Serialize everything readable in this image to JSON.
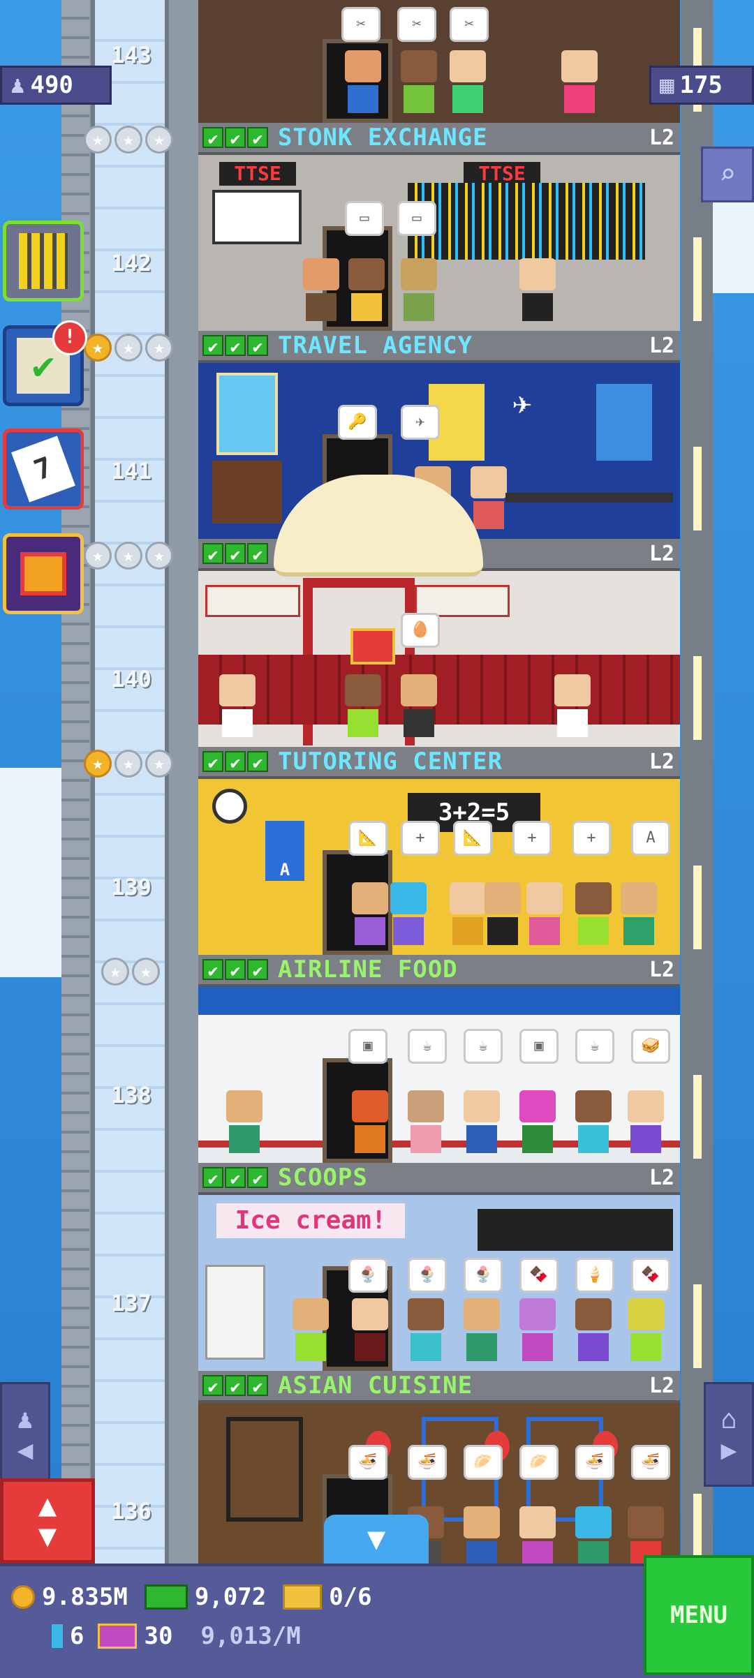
{
  "top_badges": {
    "population": "490",
    "floors": "175"
  },
  "elevator_numbers": [
    "143",
    "142",
    "141",
    "140",
    "139",
    "138",
    "137",
    "136"
  ],
  "floors": [
    {
      "name": "STONK EXCHANGE",
      "level": "L2",
      "checks": [
        "✔",
        "✔",
        "✔"
      ]
    },
    {
      "name": "TRAVEL AGENCY",
      "level": "L2",
      "checks": [
        "✔",
        "✔",
        "✔"
      ]
    },
    {
      "name": "",
      "level": "L2",
      "checks": [
        "✔",
        "✔",
        "✔"
      ]
    },
    {
      "name": "TUTORING CENTER",
      "level": "L2",
      "checks": [
        "✔",
        "✔",
        "✔"
      ]
    },
    {
      "name": "AIRLINE FOOD",
      "level": "L2",
      "checks": [
        "✔",
        "✔",
        "✔"
      ]
    },
    {
      "name": "SCOOPS",
      "level": "L2",
      "checks": [
        "✔",
        "✔",
        "✔"
      ]
    },
    {
      "name": "ASIAN CUISINE",
      "level": "L2",
      "checks": [
        "✔",
        "✔",
        "✔"
      ]
    }
  ],
  "room_signs": {
    "ttse_1": "TTSE",
    "ttse_2": "TTSE",
    "math_board": "3+2=5",
    "ice_cream": "Ice cream!",
    "apple_letter": "A"
  },
  "left_menu": {
    "notification": "!",
    "calendar_day": "7"
  },
  "hud": {
    "coins": "9.835M",
    "bux": "9,072",
    "tickets": "0/6",
    "gems": "6",
    "vip": "30",
    "rate": "9,013/M",
    "menu_label": "MENU"
  },
  "colors": {
    "sky": "#2f8fd8",
    "hud": "#555a99",
    "menu": "#27c93a",
    "floor_bar": "#7c7f86",
    "label_blue": "#6de6ff",
    "label_green": "#98f56a"
  }
}
